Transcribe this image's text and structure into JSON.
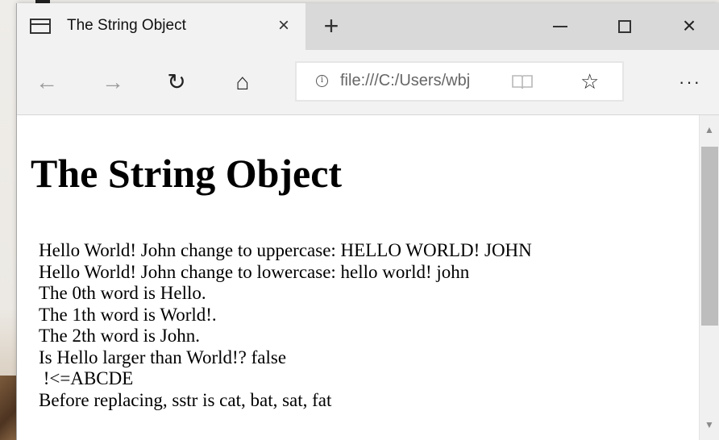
{
  "browser": {
    "tab_title": "The String Object",
    "tab_close": "×",
    "new_tab": "+",
    "window_close": "×",
    "nav": {
      "back": "←",
      "forward": "→",
      "refresh": "↻",
      "home": "⌂",
      "more": "···"
    },
    "address": {
      "info": "i",
      "url": "file:///C:/Users/wbj",
      "favorite": "☆"
    }
  },
  "page": {
    "heading": "The String Object",
    "lines": [
      "Hello World! John change to uppercase: HELLO WORLD! JOHN",
      "Hello World! John change to lowercase: hello world! john",
      "The 0th word is Hello.",
      "The 1th word is World!.",
      "The 2th word is John.",
      "Is Hello larger than World!? false",
      " !<=ABCDE",
      "Before replacing, sstr is cat, bat, sat, fat"
    ]
  },
  "scrollbar": {
    "up": "▲",
    "down": "▼"
  },
  "colors": {
    "titlebar": "#d9d9d9",
    "active_tab": "#f2f2f2",
    "navbar": "#f2f2f2",
    "scroll_thumb": "#bdbdbd"
  }
}
